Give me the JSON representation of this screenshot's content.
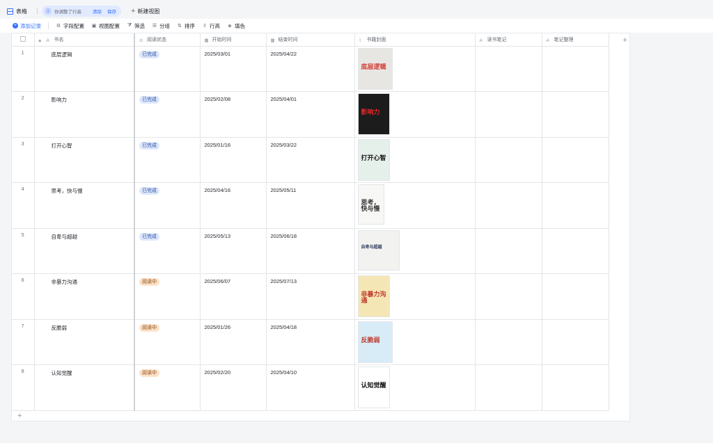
{
  "view_tab": {
    "label": "表格"
  },
  "notice": {
    "icon": "i",
    "text": "你调整了行高",
    "clear": "清除",
    "save": "保存"
  },
  "new_view": "新建视图",
  "toolbar": {
    "add_record": "添加记录",
    "field_config": "字段配置",
    "view_config": "视图配置",
    "filter": "筛选",
    "group": "分组",
    "sort": "排序",
    "row_height": "行高",
    "fill_color": "填色"
  },
  "columns": {
    "book_name": "书名",
    "status": "阅读状态",
    "start": "开始时间",
    "end": "结束时间",
    "cover": "书籍封面",
    "notes": "读书笔记",
    "summary": "笔记整理"
  },
  "rows": [
    {
      "idx": "1",
      "name": "底层逻辑",
      "status": "已完成",
      "start": "2025/03/01",
      "end": "2025/04/22",
      "cover": {
        "title": "底层逻辑",
        "bg": "#e8e6e3",
        "fg": "#d23a33"
      }
    },
    {
      "idx": "2",
      "name": "影响力",
      "status": "已完成",
      "start": "2025/02/08",
      "end": "2025/04/01",
      "cover": {
        "title": "影响力",
        "bg": "#1c1c1c",
        "fg": "#e02828"
      }
    },
    {
      "idx": "3",
      "name": "打开心智",
      "status": "已完成",
      "start": "2025/01/16",
      "end": "2025/03/22",
      "cover": {
        "title": "打开心智",
        "bg": "#e6f0ea",
        "fg": "#1a1a1a"
      }
    },
    {
      "idx": "4",
      "name": "思考，快与慢",
      "status": "已完成",
      "start": "2025/04/16",
      "end": "2025/05/11",
      "cover": {
        "title": "思考，快与慢",
        "bg": "#f7f7f5",
        "fg": "#333333"
      }
    },
    {
      "idx": "5",
      "name": "自卑与超越",
      "status": "已完成",
      "start": "2025/05/13",
      "end": "2025/06/18",
      "cover": {
        "title": "自卑与超越",
        "bg": "#f2f2f0",
        "fg": "#2d3a5a"
      }
    },
    {
      "idx": "6",
      "name": "非暴力沟通",
      "status": "阅读中",
      "start": "2025/06/07",
      "end": "2025/07/13",
      "cover": {
        "title": "非暴力沟通",
        "bg": "#f4e7b5",
        "fg": "#c0392b"
      }
    },
    {
      "idx": "7",
      "name": "反脆弱",
      "status": "阅读中",
      "start": "2025/01/26",
      "end": "2025/04/18",
      "cover": {
        "title": "反脆弱",
        "bg": "#d8ecf7",
        "fg": "#c0392b"
      }
    },
    {
      "idx": "8",
      "name": "认知觉醒",
      "status": "阅读中",
      "start": "2025/02/20",
      "end": "2025/04/10",
      "cover": {
        "title": "认知觉醒",
        "bg": "#ffffff",
        "fg": "#111111"
      }
    }
  ]
}
